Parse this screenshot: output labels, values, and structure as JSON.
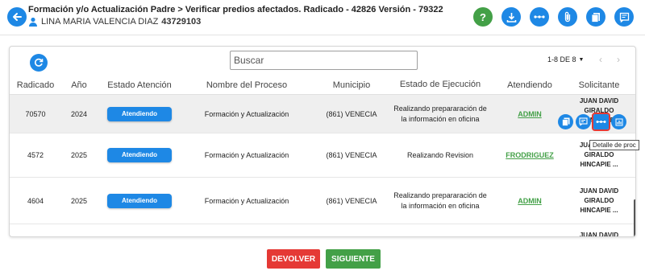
{
  "header": {
    "breadcrumb_parent": "Formación y/o Actualización Padre",
    "breadcrumb_sep": ">",
    "breadcrumb_current": "Verificar predios afectados. Radicado - 42826 Versión - 79322",
    "user_name": "LINA MARIA VALENCIA DIAZ",
    "user_id": "43729103",
    "icons": [
      "help-icon",
      "download-icon",
      "more-icon",
      "attachment-icon",
      "document-icon",
      "notes-icon"
    ]
  },
  "search": {
    "placeholder": "Buscar"
  },
  "pager": {
    "label": "1-8 DE 8",
    "caret": "▼",
    "prev": "‹",
    "next": "›"
  },
  "table": {
    "columns": [
      "Radicado",
      "Año",
      "Estado Atención",
      "Nombre del Proceso",
      "Municipio",
      "Estado de Ejecución",
      "Atendiendo",
      "Solicitante"
    ],
    "rows": [
      {
        "radicado": "70570",
        "anio": "2024",
        "estado": "Atendiendo",
        "proceso": "Formación y Actualización",
        "municipio": "(861) VENECIA",
        "ejecucion": "Realizando prepararación de la información en oficina",
        "atendiendo": "ADMIN",
        "solicitante": "JUAN DAVID GIRALDO HINCAPIE"
      },
      {
        "radicado": "4572",
        "anio": "2025",
        "estado": "Atendiendo",
        "proceso": "Formación y Actualización",
        "municipio": "(861) VENECIA",
        "ejecucion": "Realizando Revision",
        "atendiendo": "FRODRIGUEZ",
        "solicitante": "JUAN DAVID GIRALDO HINCAPIE ..."
      },
      {
        "radicado": "4604",
        "anio": "2025",
        "estado": "Atendiendo",
        "proceso": "Formación y Actualización",
        "municipio": "(861) VENECIA",
        "ejecucion": "Realizando prepararación de la información en oficina",
        "atendiendo": "ADMIN",
        "solicitante": "JUAN DAVID GIRALDO HINCAPIE ..."
      },
      {
        "solicitante": "JUAN DAVID"
      }
    ]
  },
  "tooltip": "Detalle de proc",
  "footer": {
    "devolver": "DEVOLVER",
    "siguiente": "SIGUIENTE"
  },
  "colors": {
    "primary": "#1e88e5",
    "success": "#43a047",
    "danger": "#e53935"
  }
}
